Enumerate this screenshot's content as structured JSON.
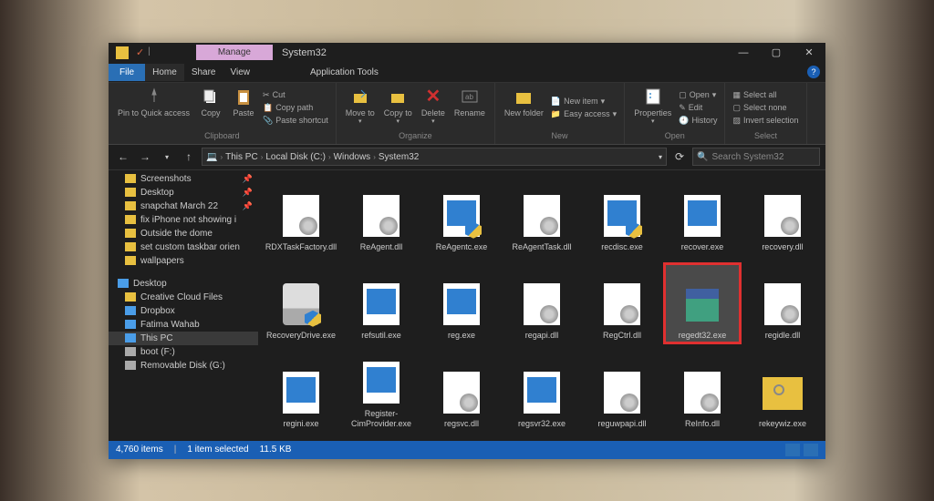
{
  "window": {
    "contextual_tab": "Manage",
    "title": "System32",
    "app_tools_label": "Application Tools"
  },
  "menubar": {
    "file": "File",
    "home": "Home",
    "share": "Share",
    "view": "View"
  },
  "ribbon": {
    "clipboard": {
      "label": "Clipboard",
      "pin": "Pin to Quick access",
      "copy": "Copy",
      "paste": "Paste",
      "cut": "Cut",
      "copypath": "Copy path",
      "pasteshortcut": "Paste shortcut"
    },
    "organize": {
      "label": "Organize",
      "moveto": "Move to",
      "copyto": "Copy to",
      "delete": "Delete",
      "rename": "Rename"
    },
    "new": {
      "label": "New",
      "newfolder": "New folder",
      "newitem": "New item",
      "easyaccess": "Easy access"
    },
    "open": {
      "label": "Open",
      "properties": "Properties",
      "open": "Open",
      "edit": "Edit",
      "history": "History"
    },
    "select": {
      "label": "Select",
      "selectall": "Select all",
      "selectnone": "Select none",
      "invert": "Invert selection"
    }
  },
  "breadcrumb": [
    "This PC",
    "Local Disk (C:)",
    "Windows",
    "System32"
  ],
  "search_placeholder": "Search System32",
  "sidebar": {
    "quick": [
      {
        "label": "Screenshots",
        "pin": true,
        "icon": "folder"
      },
      {
        "label": "Desktop",
        "pin": true,
        "icon": "folder"
      },
      {
        "label": "snapchat March 22",
        "pin": true,
        "icon": "folder"
      },
      {
        "label": "fix iPhone not showing i",
        "pin": false,
        "icon": "folder"
      },
      {
        "label": "Outside the dome",
        "pin": false,
        "icon": "folder"
      },
      {
        "label": "set custom taskbar orien",
        "pin": false,
        "icon": "folder"
      },
      {
        "label": "wallpapers",
        "pin": false,
        "icon": "folder"
      }
    ],
    "desktop": {
      "label": "Desktop"
    },
    "desktop_items": [
      {
        "label": "Creative Cloud Files",
        "icon": "folder"
      },
      {
        "label": "Dropbox",
        "icon": "blue"
      },
      {
        "label": "Fatima Wahab",
        "icon": "blue"
      },
      {
        "label": "This PC",
        "icon": "blue",
        "selected": true
      },
      {
        "label": "boot (F:)",
        "icon": "drive"
      },
      {
        "label": "Removable Disk (G:)",
        "icon": "drive"
      }
    ]
  },
  "files": [
    {
      "name": "RDXTaskFactory.dll",
      "type": "dll"
    },
    {
      "name": "ReAgent.dll",
      "type": "dll"
    },
    {
      "name": "ReAgentc.exe",
      "type": "exe-shield"
    },
    {
      "name": "ReAgentTask.dll",
      "type": "dll"
    },
    {
      "name": "recdisc.exe",
      "type": "exe-shield"
    },
    {
      "name": "recover.exe",
      "type": "exe-blue"
    },
    {
      "name": "recovery.dll",
      "type": "dll"
    },
    {
      "name": "RecoveryDrive.exe",
      "type": "exe-drive"
    },
    {
      "name": "refsutil.exe",
      "type": "exe-blue"
    },
    {
      "name": "reg.exe",
      "type": "exe-blue"
    },
    {
      "name": "regapi.dll",
      "type": "dll"
    },
    {
      "name": "RegCtrl.dll",
      "type": "dll"
    },
    {
      "name": "regedt32.exe",
      "type": "reged",
      "selected": true,
      "highlighted": true
    },
    {
      "name": "regidle.dll",
      "type": "dll"
    },
    {
      "name": "regini.exe",
      "type": "exe-blue"
    },
    {
      "name": "Register-CimProvider.exe",
      "type": "exe-blue"
    },
    {
      "name": "regsvc.dll",
      "type": "dll"
    },
    {
      "name": "regsvr32.exe",
      "type": "exe-blue"
    },
    {
      "name": "reguwpapi.dll",
      "type": "dll"
    },
    {
      "name": "ReInfo.dll",
      "type": "dll"
    },
    {
      "name": "rekeywiz.exe",
      "type": "folder-key"
    }
  ],
  "status": {
    "count": "4,760 items",
    "selection": "1 item selected",
    "size": "11.5 KB"
  }
}
